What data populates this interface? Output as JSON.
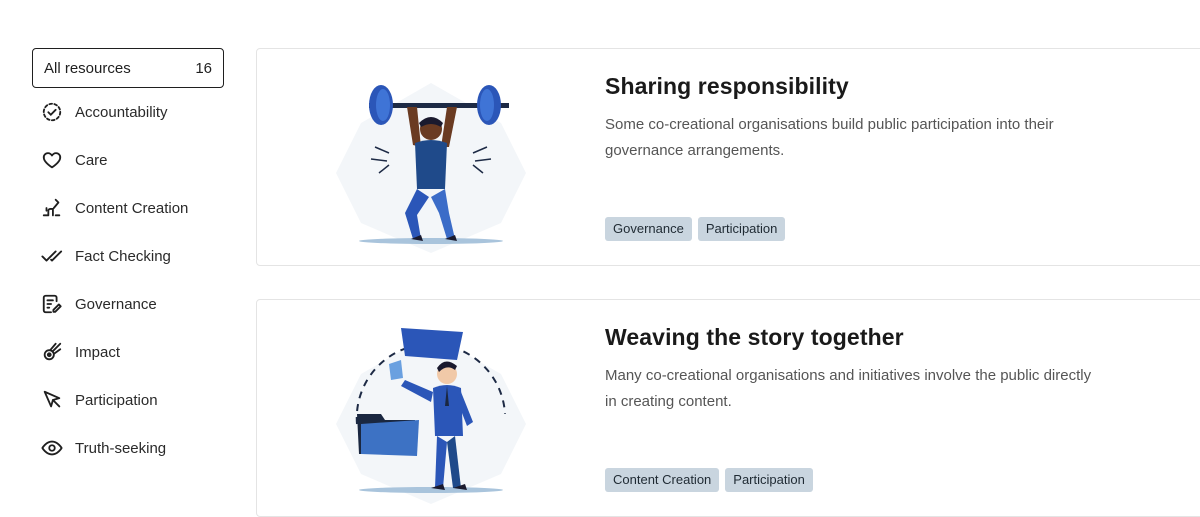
{
  "sidebar": {
    "all": {
      "label": "All resources",
      "count": "16"
    },
    "items": [
      {
        "label": "Accountability",
        "icon": "dashed-check-circle-icon"
      },
      {
        "label": "Care",
        "icon": "heart-icon"
      },
      {
        "label": "Content Creation",
        "icon": "hand-pen-icon"
      },
      {
        "label": "Fact Checking",
        "icon": "double-check-icon"
      },
      {
        "label": "Governance",
        "icon": "document-pen-icon"
      },
      {
        "label": "Impact",
        "icon": "comet-icon"
      },
      {
        "label": "Participation",
        "icon": "cursor-arrow-icon"
      },
      {
        "label": "Truth-seeking",
        "icon": "eye-icon"
      }
    ]
  },
  "cards": [
    {
      "title": "Sharing responsibility",
      "description": "Some co-creational organisations build public participation into their governance arrangements.",
      "tags": [
        "Governance",
        "Participation"
      ]
    },
    {
      "title": "Weaving the story together",
      "description": "Many co-creational organisations and initiatives involve the public directly in creating content.",
      "tags": [
        "Content Creation",
        "Participation"
      ]
    }
  ],
  "colors": {
    "accent_blue": "#2b56b8",
    "tag_bg": "#c9d5df",
    "border": "#e4e4e4"
  }
}
